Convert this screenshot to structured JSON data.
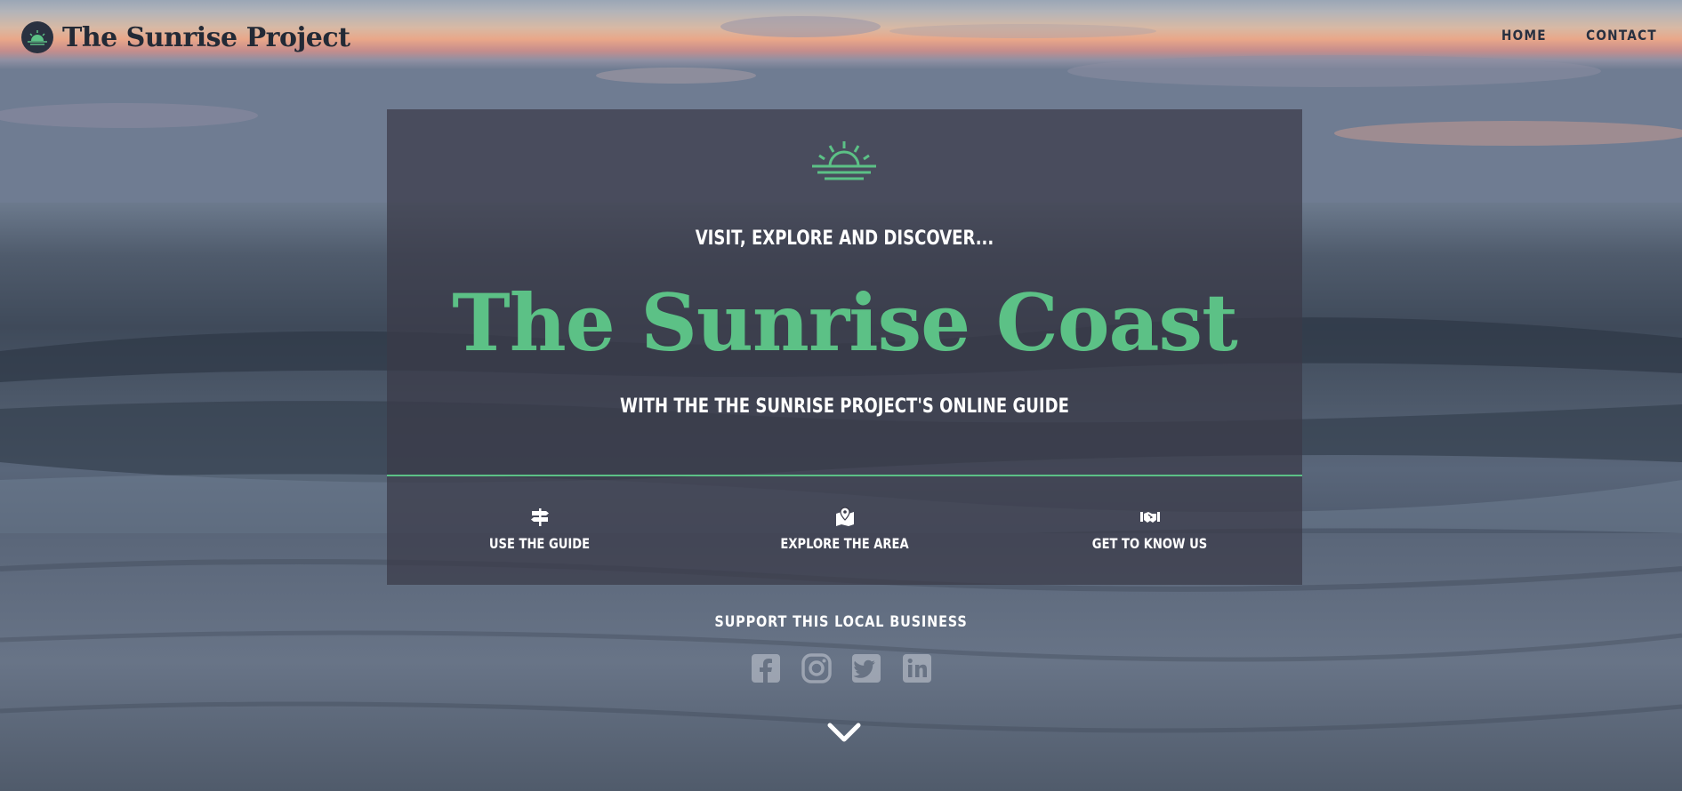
{
  "brand": {
    "name": "The Sunrise Project",
    "logo_icon": "sunrise-logo-icon"
  },
  "nav": {
    "items": [
      {
        "label": "HOME"
      },
      {
        "label": "CONTACT"
      }
    ]
  },
  "hero": {
    "icon": "sunrise-icon",
    "kicker_plain": "VISIT, EXPLORE AND ",
    "kicker_bold": "DISCOVER...",
    "title": "The Sunrise Coast",
    "tagline_plain": "WITH THE ",
    "tagline_bold": "THE SUNRISE PROJECT'S ONLINE GUIDE",
    "features": [
      {
        "label": "USE THE GUIDE",
        "icon": "signpost-icon"
      },
      {
        "label": "EXPLORE THE AREA",
        "icon": "map-marker-icon"
      },
      {
        "label": "GET TO KNOW US",
        "icon": "handshake-icon"
      }
    ]
  },
  "support": {
    "label": "SUPPORT THIS LOCAL BUSINESS",
    "social": [
      "facebook-icon",
      "instagram-icon",
      "twitter-icon",
      "linkedin-icon"
    ]
  },
  "scroll": {
    "icon": "chevron-down-icon"
  },
  "colors": {
    "accent": "#5cc186",
    "overlay": "#3a3a48",
    "nav_text": "#283040",
    "white": "#ffffff"
  }
}
